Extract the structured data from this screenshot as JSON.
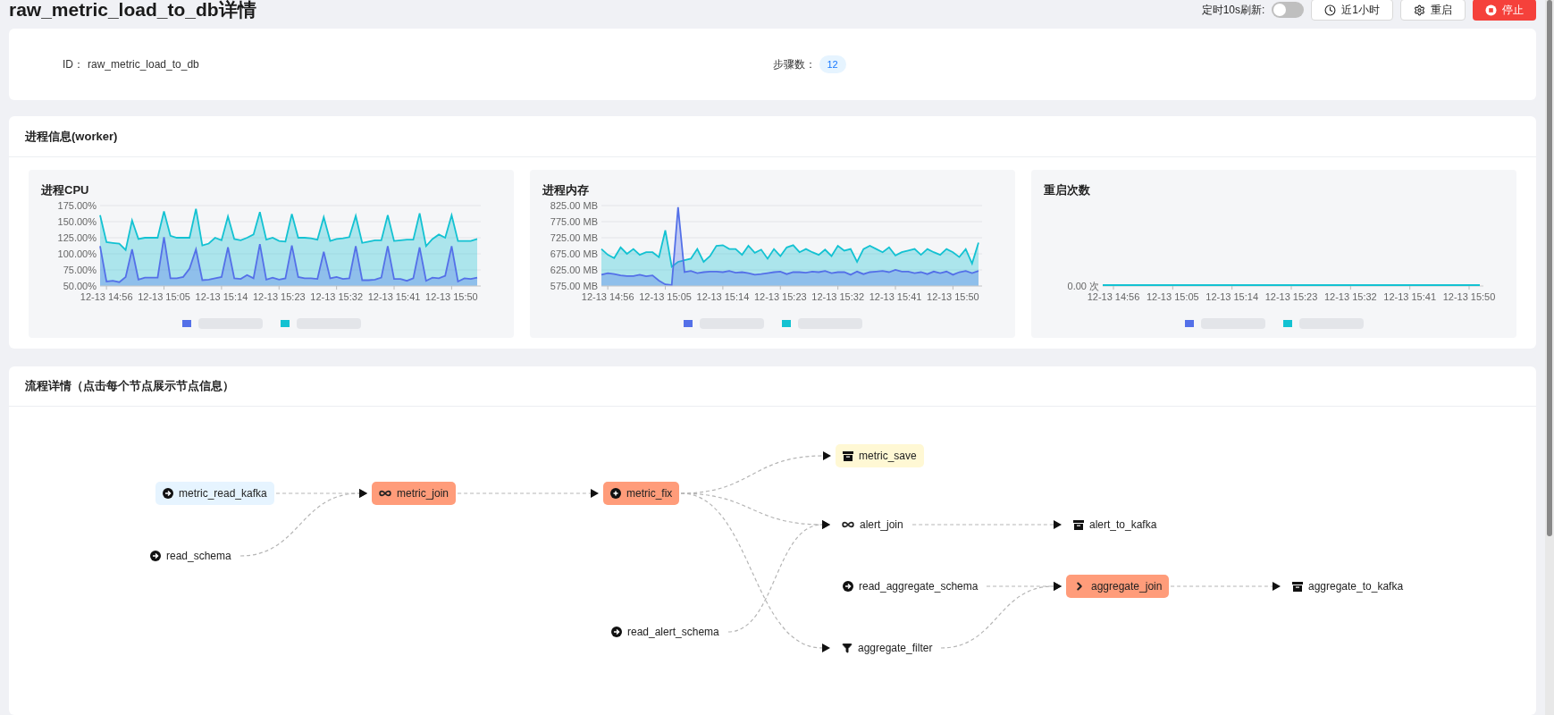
{
  "header": {
    "title": "raw_metric_load_to_db详情",
    "auto_refresh": {
      "label": "定时10s刷新:",
      "on": false
    },
    "buttons": [
      {
        "label": "近1小时",
        "kind": "clock"
      },
      {
        "label": "重启",
        "kind": "gear"
      },
      {
        "label": "停止",
        "kind": "stop"
      }
    ]
  },
  "info": [
    {
      "label": "ID：",
      "value": "raw_metric_load_to_db",
      "kind": "text"
    },
    {
      "label": "步骤数：",
      "value": "12",
      "kind": "badge"
    }
  ],
  "process": {
    "title": "进程信息(worker)",
    "charts": [
      {
        "title": "进程CPU",
        "legend": [
          {
            "color": "#5470e8"
          },
          {
            "color": "#13c2d2"
          }
        ],
        "chart_data": {
          "type": "area",
          "grid": true,
          "ylim": [
            50,
            175
          ],
          "yticks": [
            {
              "value": 50,
              "label": "50.00%"
            },
            {
              "value": 75,
              "label": "75.00%"
            },
            {
              "value": 100,
              "label": "100.00%"
            },
            {
              "value": 125,
              "label": "125.00%"
            },
            {
              "value": 150,
              "label": "150.00%"
            },
            {
              "value": 175,
              "label": "175.00%"
            }
          ],
          "categories": [
            null,
            "12-13 14:56",
            null,
            null,
            null,
            null,
            null,
            null,
            null,
            null,
            "12-13 15:05",
            null,
            null,
            null,
            null,
            null,
            null,
            null,
            null,
            "12-13 15:14",
            null,
            null,
            null,
            null,
            null,
            null,
            null,
            null,
            "12-13 15:23",
            null,
            null,
            null,
            null,
            null,
            null,
            null,
            null,
            "12-13 15:32",
            null,
            null,
            null,
            null,
            null,
            null,
            null,
            null,
            "12-13 15:41",
            null,
            null,
            null,
            null,
            null,
            null,
            null,
            null,
            "12-13 15:50",
            null,
            null,
            null,
            null
          ],
          "series": [
            {
              "color": "#5470e8",
              "values": [
                112,
                57,
                58,
                56,
                64,
                107,
                60,
                63,
                63,
                63,
                126,
                62,
                62,
                64,
                77,
                107,
                59,
                60,
                62,
                64,
                110,
                62,
                61,
                67,
                62,
                115,
                60,
                63,
                60,
                62,
                113,
                64,
                62,
                62,
                61,
                103,
                62,
                64,
                61,
                62,
                112,
                59,
                59,
                60,
                63,
                112,
                61,
                61,
                58,
                62,
                110,
                58,
                63,
                62,
                66,
                112,
                57,
                62,
                61,
                63
              ]
            },
            {
              "color": "#13c2d2",
              "values": [
                160,
                118,
                117,
                116,
                106,
                152,
                123,
                125,
                125,
                125,
                166,
                128,
                125,
                125,
                125,
                170,
                113,
                116,
                125,
                121,
                158,
                123,
                121,
                125,
                130,
                165,
                122,
                125,
                120,
                119,
                162,
                125,
                125,
                124,
                122,
                157,
                120,
                123,
                124,
                126,
                159,
                117,
                119,
                121,
                121,
                160,
                120,
                121,
                122,
                122,
                163,
                112,
                123,
                130,
                125,
                160,
                120,
                120,
                120,
                123
              ]
            }
          ]
        }
      },
      {
        "title": "进程内存",
        "legend": [
          {
            "color": "#5470e8"
          },
          {
            "color": "#13c2d2"
          }
        ],
        "chart_data": {
          "type": "area",
          "grid": true,
          "ylim": [
            575,
            825
          ],
          "yticks": [
            {
              "value": 575,
              "label": "575.00 MB"
            },
            {
              "value": 625,
              "label": "625.00 MB"
            },
            {
              "value": 675,
              "label": "675.00 MB"
            },
            {
              "value": 725,
              "label": "725.00 MB"
            },
            {
              "value": 775,
              "label": "775.00 MB"
            },
            {
              "value": 825,
              "label": "825.00 MB"
            }
          ],
          "categories": [
            null,
            "12-13 14:56",
            null,
            null,
            null,
            null,
            null,
            null,
            null,
            null,
            "12-13 15:05",
            null,
            null,
            null,
            null,
            null,
            null,
            null,
            null,
            "12-13 15:14",
            null,
            null,
            null,
            null,
            null,
            null,
            null,
            null,
            "12-13 15:23",
            null,
            null,
            null,
            null,
            null,
            null,
            null,
            null,
            "12-13 15:32",
            null,
            null,
            null,
            null,
            null,
            null,
            null,
            null,
            "12-13 15:41",
            null,
            null,
            null,
            null,
            null,
            null,
            null,
            null,
            "12-13 15:50",
            null,
            null,
            null,
            null
          ],
          "series": [
            {
              "color": "#5470e8",
              "values": [
                610,
                615,
                612,
                608,
                606,
                606,
                610,
                605,
                608,
                592,
                580,
                578,
                820,
                618,
                622,
                615,
                618,
                620,
                620,
                618,
                622,
                616,
                618,
                615,
                610,
                612,
                615,
                618,
                620,
                612,
                618,
                618,
                616,
                620,
                618,
                622,
                615,
                618,
                618,
                610,
                620,
                612,
                618,
                620,
                622,
                618,
                625,
                620,
                620,
                615,
                618,
                612,
                620,
                615,
                620,
                610,
                618,
                622,
                615,
                622
              ]
            },
            {
              "color": "#13c2d2",
              "values": [
                690,
                672,
                662,
                695,
                675,
                690,
                672,
                680,
                680,
                665,
                748,
                635,
                650,
                655,
                660,
                690,
                650,
                668,
                700,
                702,
                690,
                690,
                672,
                700,
                678,
                688,
                660,
                690,
                668,
                695,
                702,
                680,
                690,
                680,
                672,
                688,
                668,
                700,
                685,
                690,
                650,
                690,
                700,
                690,
                680,
                695,
                670,
                680,
                685,
                690,
                672,
                690,
                680,
                672,
                690,
                680,
                665,
                690,
                645,
                710
              ]
            }
          ]
        }
      },
      {
        "title": "重启次数",
        "legend": [
          {
            "color": "#5470e8"
          },
          {
            "color": "#13c2d2"
          }
        ],
        "y_labels": [
          "0.00 次"
        ],
        "x_labels": [
          "12-13 14:56",
          "12-13 15:05",
          "12-13 15:14",
          "12-13 15:23",
          "12-13 15:32",
          "12-13 15:41",
          "12-13 15:50"
        ]
      }
    ]
  },
  "flow": {
    "title": "流程详情（点击每个节点展示节点信息）",
    "nodes": [
      {
        "label": "metric_read_kafka",
        "kind": "source",
        "color": "#e6f4ff"
      },
      {
        "label": "read_schema",
        "kind": "source"
      },
      {
        "label": "metric_join",
        "kind": "join",
        "color": "#ff9c7a"
      },
      {
        "label": "metric_fix",
        "kind": "transform",
        "color": "#ff9c7a"
      },
      {
        "label": "read_alert_schema",
        "kind": "source"
      },
      {
        "label": "metric_save",
        "kind": "sink",
        "color": "#fff8d4"
      },
      {
        "label": "alert_join",
        "kind": "join"
      },
      {
        "label": "alert_to_kafka",
        "kind": "sink"
      },
      {
        "label": "read_aggregate_schema",
        "kind": "source"
      },
      {
        "label": "aggregate_join",
        "kind": "compare",
        "color": "#ff9c7a"
      },
      {
        "label": "aggregate_to_kafka",
        "kind": "sink"
      },
      {
        "label": "aggregate_filter",
        "kind": "filter"
      }
    ]
  }
}
